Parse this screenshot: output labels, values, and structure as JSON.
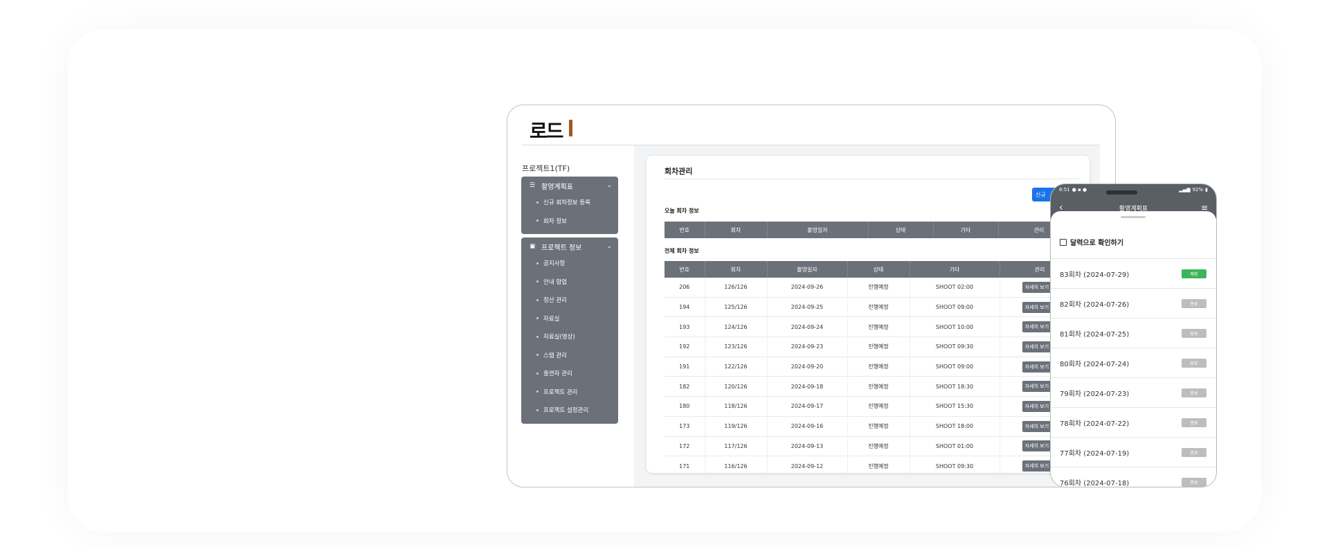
{
  "desktop": {
    "logo": {
      "text": "로드",
      "bar_color": "#a55524"
    },
    "sidebar": {
      "project_name": "프로젝트1(TF)",
      "groups": [
        {
          "icon": "list-icon",
          "title": "촬영계획표",
          "items": [
            "신규 회차정보 등록",
            "회차 정보"
          ]
        },
        {
          "icon": "folder-icon",
          "title": "프로젝트 정보",
          "items": [
            "공지사항",
            "안내 합업",
            "정산 관리",
            "자료실",
            "자료실(영상)",
            "스텝 관리",
            "출연자 관리",
            "프로젝트 관리",
            "프로젝트 설정관리"
          ]
        }
      ]
    },
    "main": {
      "title": "회차관리",
      "new_button": "신규",
      "today_title": "오늘 회차 정보",
      "all_title": "전체 회차 정보",
      "columns": [
        "번호",
        "회차",
        "촬영일자",
        "상태",
        "기타",
        "관리"
      ],
      "detail_label": "자세히 보기 >",
      "rows": [
        [
          "206",
          "126/126",
          "2024-09-26",
          "진행예정",
          "SHOOT 02:00"
        ],
        [
          "194",
          "125/126",
          "2024-09-25",
          "진행예정",
          "SHOOT 09:00"
        ],
        [
          "193",
          "124/126",
          "2024-09-24",
          "진행예정",
          "SHOOT 10:00"
        ],
        [
          "192",
          "123/126",
          "2024-09-23",
          "진행예정",
          "SHOOT 09:30"
        ],
        [
          "191",
          "122/126",
          "2024-09-20",
          "진행예정",
          "SHOOT 09:00"
        ],
        [
          "182",
          "120/126",
          "2024-09-18",
          "진행예정",
          "SHOOT 18:30"
        ],
        [
          "180",
          "118/126",
          "2024-09-17",
          "진행예정",
          "SHOOT 15:30"
        ],
        [
          "173",
          "119/126",
          "2024-09-16",
          "진행예정",
          "SHOOT 18:00"
        ],
        [
          "172",
          "117/126",
          "2024-09-13",
          "진행예정",
          "SHOOT 01:00"
        ],
        [
          "171",
          "116/126",
          "2024-09-12",
          "진행예정",
          "SHOOT 09:30"
        ]
      ]
    }
  },
  "phone": {
    "status": {
      "time": "6:51",
      "battery": "92%"
    },
    "title": "촬영계획표",
    "calendar_label": "달력으로 확인하기",
    "items": [
      {
        "label": "83회차 (2024-07-29)",
        "badge": "예정",
        "color": "#3cb55a"
      },
      {
        "label": "82회차 (2024-07-26)",
        "badge": "종료",
        "color": "#bdbdbd"
      },
      {
        "label": "81회차 (2024-07-25)",
        "badge": "종료",
        "color": "#bdbdbd"
      },
      {
        "label": "80회차 (2024-07-24)",
        "badge": "종료",
        "color": "#bdbdbd"
      },
      {
        "label": "79회차 (2024-07-23)",
        "badge": "종료",
        "color": "#bdbdbd"
      },
      {
        "label": "78회차 (2024-07-22)",
        "badge": "종료",
        "color": "#bdbdbd"
      },
      {
        "label": "77회차 (2024-07-19)",
        "badge": "종료",
        "color": "#bdbdbd"
      },
      {
        "label": "76회차 (2024-07-18)",
        "badge": "종료",
        "color": "#bdbdbd"
      }
    ]
  }
}
